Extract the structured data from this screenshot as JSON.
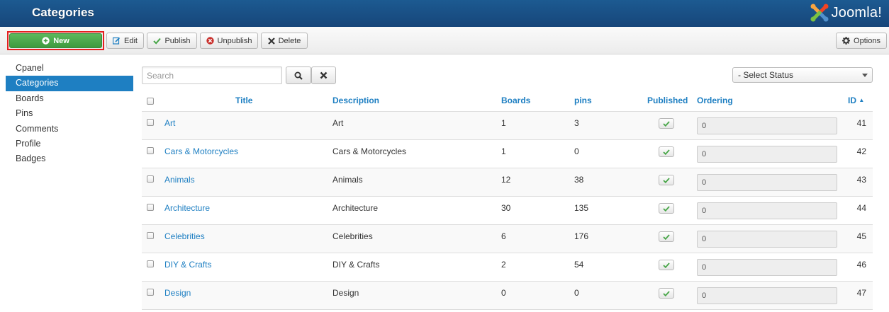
{
  "header": {
    "title": "Categories",
    "brand": "Joomla!"
  },
  "toolbar": {
    "new_label": "New",
    "edit_label": "Edit",
    "publish_label": "Publish",
    "unpublish_label": "Unpublish",
    "delete_label": "Delete",
    "options_label": "Options"
  },
  "sidebar": {
    "items": [
      {
        "label": "Cpanel"
      },
      {
        "label": "Categories",
        "active": true
      },
      {
        "label": "Boards"
      },
      {
        "label": "Pins"
      },
      {
        "label": "Comments"
      },
      {
        "label": "Profile"
      },
      {
        "label": "Badges"
      }
    ]
  },
  "filters": {
    "search_placeholder": "Search",
    "status_selected": "- Select Status"
  },
  "table": {
    "headers": {
      "title": "Title",
      "description": "Description",
      "boards": "Boards",
      "pins": "pins",
      "published": "Published",
      "ordering": "Ordering",
      "id": "ID"
    },
    "sort_indicator": "▲",
    "rows": [
      {
        "title": "Art",
        "description": "Art",
        "boards": "1",
        "pins": "3",
        "ordering": "0",
        "id": "41"
      },
      {
        "title": "Cars & Motorcycles",
        "description": "Cars & Motorcycles",
        "boards": "1",
        "pins": "0",
        "ordering": "0",
        "id": "42"
      },
      {
        "title": "Animals",
        "description": "Animals",
        "boards": "12",
        "pins": "38",
        "ordering": "0",
        "id": "43"
      },
      {
        "title": "Architecture",
        "description": "Architecture",
        "boards": "30",
        "pins": "135",
        "ordering": "0",
        "id": "44"
      },
      {
        "title": "Celebrities",
        "description": "Celebrities",
        "boards": "6",
        "pins": "176",
        "ordering": "0",
        "id": "45"
      },
      {
        "title": "DIY & Crafts",
        "description": "DIY & Crafts",
        "boards": "2",
        "pins": "54",
        "ordering": "0",
        "id": "46"
      },
      {
        "title": "Design",
        "description": "Design",
        "boards": "0",
        "pins": "0",
        "ordering": "0",
        "id": "47"
      }
    ]
  },
  "colors": {
    "header_bg": "#17467a",
    "accent": "#1e7fc2",
    "new_button": "#4cae4c",
    "highlight_border": "#e52020",
    "published_check": "#46a546",
    "delete_icon": "#c9302c"
  }
}
